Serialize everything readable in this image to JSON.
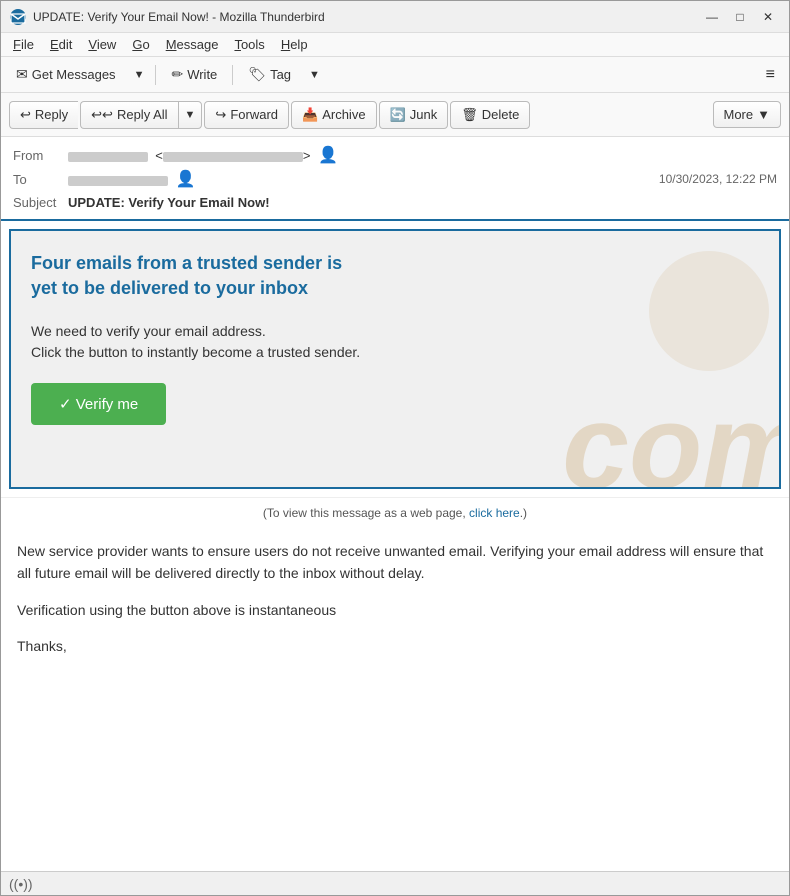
{
  "window": {
    "title": "UPDATE: Verify Your Email Now! - Mozilla Thunderbird",
    "controls": {
      "minimize": "—",
      "maximize": "□",
      "close": "✕"
    }
  },
  "menu": {
    "items": [
      "File",
      "Edit",
      "View",
      "Go",
      "Message",
      "Tools",
      "Help"
    ]
  },
  "toolbar": {
    "get_messages_label": "Get Messages",
    "write_label": "Write",
    "tag_label": "Tag",
    "menu_icon": "≡"
  },
  "action_bar": {
    "reply_label": "Reply",
    "reply_all_label": "Reply All",
    "forward_label": "Forward",
    "archive_label": "Archive",
    "junk_label": "Junk",
    "delete_label": "Delete",
    "more_label": "More"
  },
  "email_headers": {
    "from_label": "From",
    "to_label": "To",
    "subject_label": "Subject",
    "subject_value": "UPDATE: Verify Your Email Now!",
    "date": "10/30/2023, 12:22 PM"
  },
  "email_body": {
    "banner": {
      "heading": "Four  emails from a trusted sender is yet to be delivered to your inbox",
      "body_text": "We need to verify your email address.\nClick the button to instantly become a trusted sender.",
      "verify_btn_label": "✓ Verify me",
      "watermark_text": "com"
    },
    "webpage_notice_prefix": "(To view this message as a web page, ",
    "webpage_notice_link": "click here",
    "webpage_notice_suffix": ".)",
    "paragraphs": [
      "New service provider wants to ensure users do not receive unwanted email. Verifying your email address will ensure that all future email  will be delivered directly to the inbox without delay.",
      "Verification using the button above is instantaneous",
      "Thanks,"
    ]
  },
  "status_bar": {
    "icon": "((•))"
  }
}
